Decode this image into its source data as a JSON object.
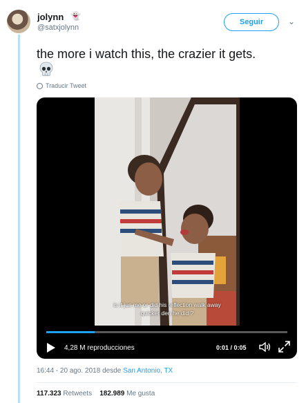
{
  "user": {
    "name": "jolynn",
    "handle": "@satxjolynn",
    "badge_emoji": "👻",
    "avatar_icon": "avatar"
  },
  "follow_label": "Seguir",
  "tweet": {
    "text": "the more i watch this, the crazier it gets.",
    "emoji": "skull",
    "translate_label": "Traducir Tweet"
  },
  "video": {
    "subtitle_line1": "is it jus me or did his reflection walk away",
    "subtitle_line2": "quicker den he did ?",
    "views": "4,28 M reproducciones",
    "time": "0:01 / 0:05",
    "progress": 0.2
  },
  "meta": {
    "time": "16:44 - 20 ago. 2018 desde ",
    "location": "San Antonio, TX"
  },
  "stats": {
    "retweets_count": "117.323",
    "retweets_label": "Retweets",
    "likes_count": "182.989",
    "likes_label": "Me gusta"
  },
  "colors": {
    "accent": "#1da1f2",
    "thread_line": "#b8e1f5",
    "secondary_text": "#657786"
  }
}
